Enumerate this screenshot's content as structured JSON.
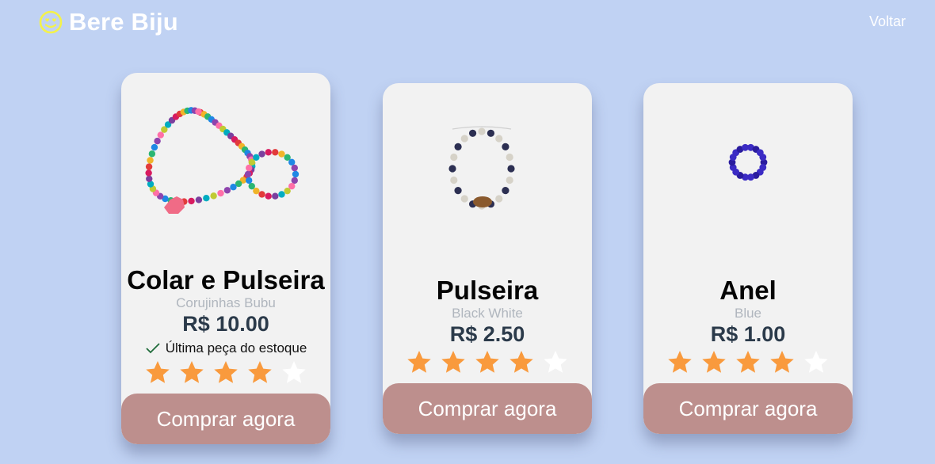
{
  "header": {
    "brand_name": "Bere Biju",
    "brand_icon": "heart-eyes-smiley-icon",
    "back_label": "Voltar"
  },
  "colors": {
    "background": "#c0d2f3",
    "card": "#f2f2f2",
    "button": "#bd8f8d",
    "star_filled": "#f99a3d",
    "star_empty": "#ffffff",
    "brand_icon": "#f4f24a"
  },
  "products": [
    {
      "title": "Colar e Pulseira",
      "variant": "Corujinhas Bubu",
      "price": "R$ 10.00",
      "stock_note": "Última peça do estoque",
      "rating": 4,
      "max_rating": 5,
      "buy_label": "Comprar agora"
    },
    {
      "title": "Pulseira",
      "variant": "Black White",
      "price": "R$ 2.50",
      "rating": 4,
      "max_rating": 5,
      "buy_label": "Comprar agora"
    },
    {
      "title": "Anel",
      "variant": "Blue",
      "price": "R$ 1.00",
      "rating": 4,
      "max_rating": 5,
      "buy_label": "Comprar agora"
    }
  ]
}
